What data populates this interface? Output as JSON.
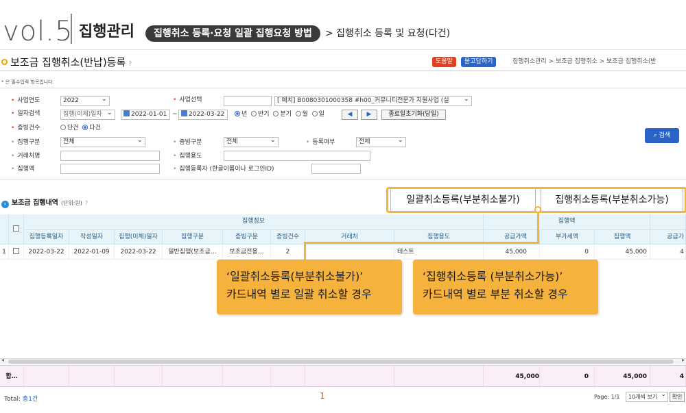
{
  "banner": {
    "vol": "vol.5",
    "title": "집행관리",
    "pill": "집행취소 등록·요청 일괄 집행요청 방법",
    "subtitle": "> 집행취소 등록 및 요청(다건)"
  },
  "header": {
    "page_title": "보조금 집행취소(반납)등록",
    "help_mark": "?",
    "help_button": "도움말",
    "faq_button": "묻고답하기",
    "breadcrumb": "집행취소관리  >  보조금 집행취소  >  보조금 집행취소(반",
    "required_note": "* 은 필수입력 항목입니다."
  },
  "form": {
    "business_year_label": "사업연도",
    "business_year_value": "2022",
    "business_select_label": "사업선택",
    "business_select_value": "[   예치] B0080301000358 #h00_커뮤니티전문가 지원사업 (실",
    "date_search_label": "일자검색",
    "date_type_value": "집행(이체)일자",
    "date_from": "2022-01-01",
    "date_sep": "~",
    "date_to": "2022-03-22",
    "period_options": [
      "년",
      "반기",
      "분기",
      "월",
      "일"
    ],
    "prev_btn": "◀",
    "next_btn": "▶",
    "reset_btn": "종료일초기화(당일)",
    "evidence_count_label": "증빙건수",
    "evidence_options": [
      "단건",
      "다건"
    ],
    "exec_type_label": "집행구분",
    "exec_type_value": "전체",
    "evidence_type_label": "증빙구분",
    "evidence_type_value": "전체",
    "register_label": "등록여부",
    "register_value": "전체",
    "vendor_label": "거래처명",
    "purpose_label": "집행용도",
    "amount_label": "집행액",
    "registrant_label": "집행등록자 (한글이름이나 로그인ID)",
    "search_btn": "검색"
  },
  "section": {
    "title": "보조금 집행내역",
    "unit": "(단위:원)",
    "help": "?",
    "bulk_cancel_btn": "일괄취소등록(부분취소불가)",
    "partial_cancel_btn": "집행취소등록(부분취소가능)"
  },
  "grid": {
    "group_exec_info": "집행정보",
    "group_amount": "집행액",
    "headers": [
      "집행등록일자",
      "작성일자",
      "집행(이체)일자",
      "집행구분",
      "증빙구분",
      "증빙건수",
      "거래처",
      "집행용도",
      "공급가액",
      "부가세액",
      "집행액",
      "공급가"
    ],
    "rows": [
      {
        "no": "1",
        "cells": [
          "2022-03-22",
          "2022-01-09",
          "2022-03-22",
          "일반집행(보조금…",
          "보조금전용…",
          "2",
          "",
          "테스트",
          "45,000",
          "0",
          "45,000",
          "4"
        ]
      }
    ],
    "sum_label": "합…",
    "sum_supply": "45,000",
    "sum_vat": "0",
    "sum_exec": "45,000",
    "sum_last": "4"
  },
  "footer": {
    "total_prefix": "Total: ",
    "total_count": "총1건",
    "current_page": "1",
    "page_info": "Page: 1/1",
    "per_page": "10개씩 보기",
    "confirm": "확인"
  },
  "callouts": {
    "left_line1": "‘일괄취소등록(부분취소불가)’",
    "left_line2": "카드내역 별로 일괄 취소할 경우",
    "right_line1": "‘집행취소등록 (부분취소가능)’",
    "right_line2": "카드내역 별로 부분 취소할 경우"
  },
  "colors": {
    "accent_orange": "#f5b23c",
    "help_red": "#e3401f",
    "primary_blue": "#2b64c8",
    "grid_header": "#e7f4fa",
    "sum_row": "#fbeff7"
  }
}
